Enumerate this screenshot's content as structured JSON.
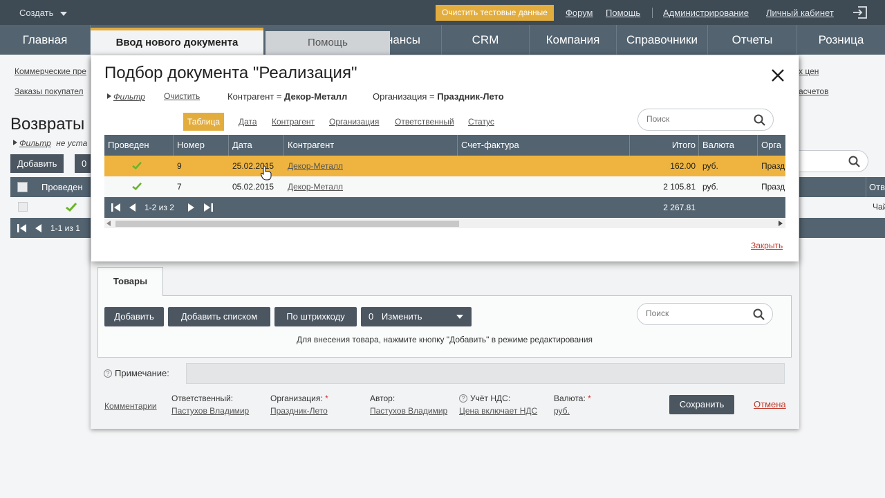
{
  "topbar": {
    "create_label": "Создать",
    "clear_test_data": "Очистить тестовые данные",
    "links": [
      "Форум",
      "Помощь",
      "Администрирование",
      "Личный кабинет"
    ]
  },
  "nav": {
    "items": [
      "Главная",
      "Финансы",
      "CRM",
      "Компания",
      "Справочники",
      "Отчеты",
      "Розница"
    ],
    "tab_new_document": "Ввод нового документа",
    "tab_help": "Помощь"
  },
  "background": {
    "sublinks": [
      "Коммерческие пре",
      "Заказы покупател",
      "х цен",
      "асчетов"
    ],
    "title": "Возвраты",
    "filter_label": "Фильтр",
    "filter_status": "не уста",
    "add_button": "Добавить",
    "counter": "0",
    "col_posted": "Проведен",
    "col_resp": "Отв",
    "row_resp": "Чай",
    "pager": "1-1 из 1"
  },
  "modal": {
    "title": "Подбор документа \"Реализация\"",
    "filter_label": "Фильтр",
    "clear_label": "Очистить",
    "filter_counterparty_label": "Контрагент =",
    "filter_counterparty_value": "Декор-Металл",
    "filter_org_label": "Организация =",
    "filter_org_value": "Праздник-Лето",
    "view_tabs": [
      "Таблица",
      "Дата",
      "Контрагент",
      "Организация",
      "Ответственный",
      "Статус"
    ],
    "search_placeholder": "Поиск",
    "columns": [
      "Проведен",
      "Номер",
      "Дата",
      "Контрагент",
      "Счет-фактура",
      "Итого",
      "Валюта",
      "Орга"
    ],
    "rows": [
      {
        "number": "9",
        "date": "25.02.2015",
        "counterparty": "Декор-Металл",
        "invoice": "",
        "total": "162.00",
        "currency": "руб.",
        "org": "Празд"
      },
      {
        "number": "7",
        "date": "05.02.2015",
        "counterparty": "Декор-Металл",
        "invoice": "",
        "total": "2 105.81",
        "currency": "руб.",
        "org": "Празд"
      }
    ],
    "pager_text": "1-2 из 2",
    "pager_total": "2 267.81",
    "close_link": "Закрыть"
  },
  "goods": {
    "tab_label": "Товары",
    "add": "Добавить",
    "add_list": "Добавить списком",
    "by_barcode": "По штрихкоду",
    "change_count": "0",
    "change_label": "Изменить",
    "search_placeholder": "Поиск",
    "hint": "Для внесения товара, нажмите кнопку \"Добавить\" в режиме редактирования"
  },
  "footer": {
    "note_label": "Примечание:",
    "comments": "Комментарии",
    "responsible_label": "Ответственный:",
    "responsible_value": "Пастухов Владимир",
    "org_label": "Организация:",
    "org_value": "Праздник-Лето",
    "author_label": "Автор:",
    "author_value": "Пастухов Владимир",
    "vat_label": "Учёт НДС:",
    "vat_value": "Цена включает НДС",
    "currency_label": "Валюта:",
    "currency_value": "руб.",
    "save": "Сохранить",
    "cancel": "Отмена"
  },
  "colors": {
    "accent": "#e3ad3e",
    "header_dark": "#3e4a54",
    "nav": "#536370",
    "link_red": "#c0392b",
    "check_green": "#6ab42d"
  }
}
